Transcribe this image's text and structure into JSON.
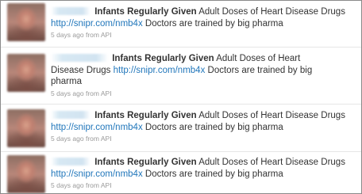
{
  "tweets": [
    {
      "headline": "Infants Regularly Given",
      "body": "Adult Doses of Heart Disease Drugs",
      "link": "http://snipr.com/nmb4x",
      "tail": "Doctors are trained by big pharma",
      "timestamp": "5 days ago",
      "source": "from API"
    },
    {
      "headline": "Infants Regularly Given",
      "body": "Adult Doses of Heart Disease Drugs",
      "link": "http://snipr.com/nmb4x",
      "tail": "Doctors are trained by big pharma",
      "timestamp": "5 days ago",
      "source": "from API"
    },
    {
      "headline": "Infants Regularly Given",
      "body": "Adult Doses of Heart Disease Drugs",
      "link": "http://snipr.com/nmb4x",
      "tail": "Doctors are trained by big pharma",
      "timestamp": "5 days ago",
      "source": "from API"
    },
    {
      "headline": "Infants Regularly Given",
      "body": "Adult Doses of Heart Disease Drugs",
      "link": "http://snipr.com/nmb4x",
      "tail": "Doctors are trained by big pharma",
      "timestamp": "5 days ago",
      "source": "from API"
    }
  ],
  "colors": {
    "link": "#2277bb",
    "text": "#333333",
    "meta": "#9a9a9a",
    "border": "#8a8a8a"
  }
}
